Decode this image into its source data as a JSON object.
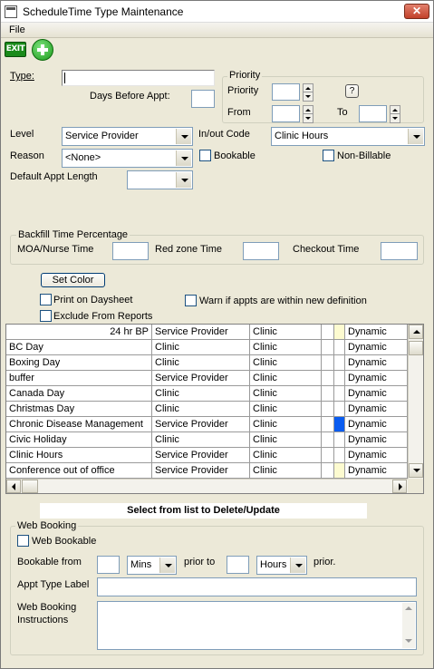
{
  "window": {
    "title": "ScheduleTime Type Maintenance",
    "close_glyph": "✕"
  },
  "menu": {
    "file": "File"
  },
  "toolbar": {
    "exit_label": "EXIT",
    "exit_icon": "exit-icon",
    "add_icon": "add-icon"
  },
  "form": {
    "type_label": "Type:",
    "type_value": "",
    "days_before_label": "Days Before Appt:",
    "days_before_value": "",
    "level_label": "Level",
    "level_value": "Service Provider",
    "reason_label": "Reason",
    "reason_value": "<None>",
    "default_appt_length_label": "Default Appt Length",
    "default_appt_length_value": "",
    "inout_code_label": "In/out Code",
    "inout_code_value": "Clinic Hours",
    "bookable_label": "Bookable",
    "non_billable_label": "Non-Billable"
  },
  "priority": {
    "group_title": "Priority",
    "priority_label": "Priority",
    "from_label": "From",
    "to_label": "To",
    "help_label": "?"
  },
  "backfill": {
    "group_title": "Backfill Time Percentage",
    "moa_label": "MOA/Nurse Time",
    "redzone_label": "Red zone Time",
    "checkout_label": "Checkout Time"
  },
  "options": {
    "set_color_label": "Set Color",
    "print_daysheet_label": "Print on Daysheet",
    "exclude_reports_label": "Exclude From Reports",
    "warn_label": "Warn if appts are within new definition"
  },
  "grid": {
    "rows": [
      {
        "name": "24 hr BP",
        "level": "Service Provider",
        "code": "Clinic",
        "color": "",
        "swatch": "#fdfbd0",
        "type": "Dynamic"
      },
      {
        "name": "BC Day",
        "level": "Clinic",
        "code": "Clinic",
        "color": "",
        "swatch": "",
        "type": "Dynamic"
      },
      {
        "name": "Boxing Day",
        "level": "Clinic",
        "code": "Clinic",
        "color": "",
        "swatch": "",
        "type": "Dynamic"
      },
      {
        "name": "buffer",
        "level": "Service Provider",
        "code": "Clinic",
        "color": "",
        "swatch": "",
        "type": "Dynamic"
      },
      {
        "name": "Canada Day",
        "level": "Clinic",
        "code": "Clinic",
        "color": "",
        "swatch": "",
        "type": "Dynamic"
      },
      {
        "name": "Christmas Day",
        "level": "Clinic",
        "code": "Clinic",
        "color": "",
        "swatch": "",
        "type": "Dynamic"
      },
      {
        "name": "Chronic Disease Management",
        "level": "Service Provider",
        "code": "Clinic",
        "color": "",
        "swatch": "#0a5cf0",
        "type": "Dynamic"
      },
      {
        "name": "Civic Holiday",
        "level": "Clinic",
        "code": "Clinic",
        "color": "",
        "swatch": "",
        "type": "Dynamic"
      },
      {
        "name": "Clinic Hours",
        "level": "Service Provider",
        "code": "Clinic",
        "color": "",
        "swatch": "",
        "type": "Dynamic"
      },
      {
        "name": "Conference out of office",
        "level": "Service Provider",
        "code": "Clinic",
        "color": "",
        "swatch": "#fdfbd0",
        "type": "Dynamic"
      }
    ]
  },
  "status": {
    "text": "Select from list to Delete/Update"
  },
  "web_booking": {
    "group_title": "Web Booking",
    "web_bookable_label": "Web Bookable",
    "bookable_from_label": "Bookable from",
    "unit1_value": "Mins",
    "prior_to_label": "prior to",
    "unit2_value": "Hours",
    "prior_label": "prior.",
    "appt_type_label": "Appt Type Label",
    "instructions_label_1": "Web Booking",
    "instructions_label_2": "Instructions"
  }
}
